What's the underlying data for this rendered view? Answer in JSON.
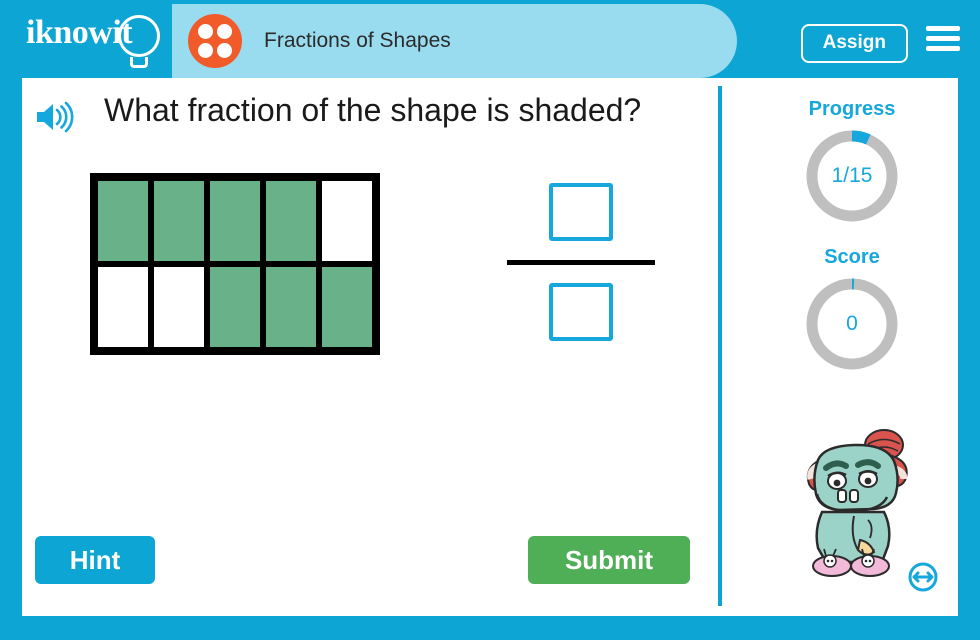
{
  "header": {
    "logo_text": "iknowit",
    "logo_icon": "lightbulb-icon",
    "title": "Fractions of Shapes",
    "badge_icon": "four-dots-icon",
    "assign_label": "Assign",
    "menu_icon": "hamburger-menu-icon"
  },
  "question": {
    "speaker_icon": "speaker-icon",
    "text": "What fraction of the shape is shaded?"
  },
  "shape": {
    "rows": 2,
    "cols": 5,
    "total_cells": 10,
    "shaded_cells": 7,
    "shaded_color": "#69B189",
    "unshaded_color": "#FFFFFF",
    "border_color": "#000000",
    "grid": [
      [
        true,
        true,
        true,
        true,
        false
      ],
      [
        false,
        false,
        true,
        true,
        true
      ]
    ]
  },
  "answer": {
    "numerator_value": "",
    "numerator_placeholder": "",
    "denominator_value": "",
    "denominator_placeholder": "",
    "box_border_color": "#16A7DC",
    "bar_color": "#000000"
  },
  "sidebar": {
    "progress": {
      "label": "Progress",
      "value": "1/15",
      "current": 1,
      "total": 15,
      "arc_color": "#16A7DC",
      "track_color": "#BFBFBF"
    },
    "score": {
      "label": "Score",
      "value": "0",
      "current": 0,
      "arc_color": "#16A7DC",
      "track_color": "#BFBFBF"
    },
    "mascot_icon": "monster-mascot",
    "resize_icon": "resize-horizontal-icon"
  },
  "actions": {
    "hint_label": "Hint",
    "hint_color": "#0CA5D4",
    "submit_label": "Submit",
    "submit_color": "#4FAF56"
  },
  "theme": {
    "primary": "#0CA5D4",
    "title_pill": "#9ADCEF",
    "badge": "#F15A29",
    "panel_bg": "#FFFFFF"
  }
}
